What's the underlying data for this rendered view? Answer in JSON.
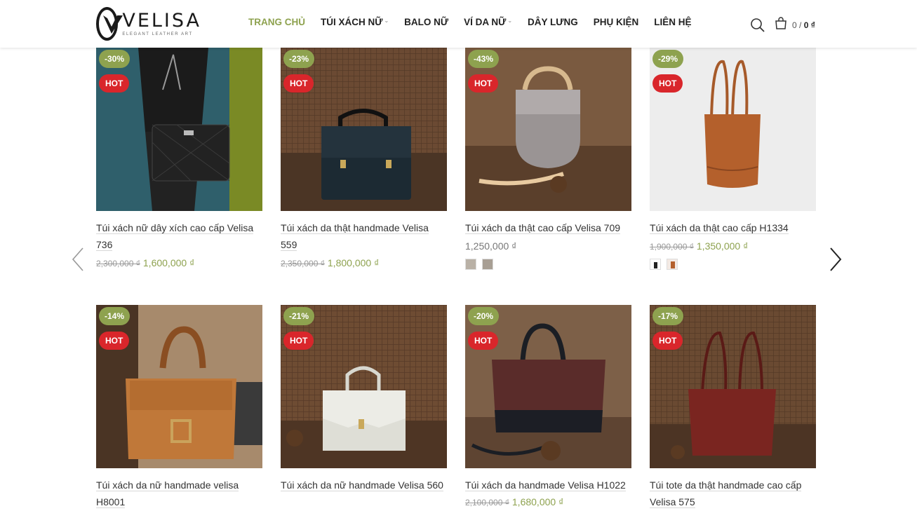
{
  "brand": {
    "name": "VELISA",
    "tagline": "ELEGANT LEATHER ART"
  },
  "nav": [
    {
      "label": "TRANG CHỦ",
      "active": true,
      "dropdown": false
    },
    {
      "label": "TÚI XÁCH NỮ",
      "active": false,
      "dropdown": true
    },
    {
      "label": "BALO NỮ",
      "active": false,
      "dropdown": false
    },
    {
      "label": "VÍ DA NỮ",
      "active": false,
      "dropdown": true
    },
    {
      "label": "DÂY LƯNG",
      "active": false,
      "dropdown": false
    },
    {
      "label": "PHỤ KIỆN",
      "active": false,
      "dropdown": false
    },
    {
      "label": "LIÊN HỆ",
      "active": false,
      "dropdown": false
    }
  ],
  "cart": {
    "count": "0 /",
    "total": "0 ₫"
  },
  "colors": {
    "accent": "#8ea24f",
    "hot": "#d9262b"
  },
  "products": [
    {
      "sale": "-30%",
      "hot": "HOT",
      "title": "Túi xách nữ dây xích cao cấp Velisa 736",
      "old_price": "2,300,000 ₫",
      "price": "1,600,000 ₫"
    },
    {
      "sale": "-23%",
      "hot": "HOT",
      "title": "Túi xách da thật handmade Velisa 559",
      "old_price": "2,350,000 ₫",
      "price": "1,800,000 ₫"
    },
    {
      "sale": "-43%",
      "hot": "HOT",
      "title": "Túi xách da thật cao cấp Velisa 709",
      "old_price": "",
      "price": "1,250,000 ₫"
    },
    {
      "sale": "-29%",
      "hot": "HOT",
      "title": "Túi xách da thật cao cấp H1334",
      "old_price": "1,900,000 ₫",
      "price": "1,350,000 ₫"
    },
    {
      "sale": "-14%",
      "hot": "HOT",
      "title": "Túi xách da nữ handmade velisa H8001",
      "old_price": "",
      "price": ""
    },
    {
      "sale": "-21%",
      "hot": "HOT",
      "title": "Túi xách da nữ handmade Velisa 560",
      "old_price": "",
      "price": ""
    },
    {
      "sale": "-20%",
      "hot": "HOT",
      "title": "Túi xách da handmade Velisa H1022",
      "old_price": "2,100,000 ₫",
      "price": "1,680,000 ₫"
    },
    {
      "sale": "-17%",
      "hot": "HOT",
      "title": "Túi tote da thật handmade cao cấp Velisa 575",
      "old_price": "",
      "price": ""
    }
  ]
}
